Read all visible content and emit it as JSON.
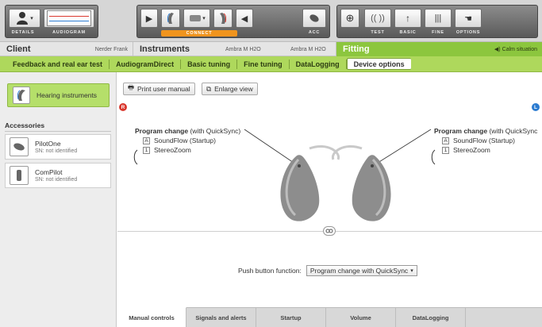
{
  "toolbar": {
    "details_label": "DETAILS",
    "audiogram_label": "AUDIOGRAM",
    "connect_label": "CONNECT",
    "acc_label": "ACC",
    "test_label": "TEST",
    "basic_label": "BASIC",
    "fine_label": "FINE",
    "options_label": "OPTIONS"
  },
  "sections": {
    "client": "Client",
    "client_name": "Nerder Frank",
    "instruments": "Instruments",
    "instrument_left": "Ambra M H2O",
    "instrument_right": "Ambra M H2O",
    "fitting": "Fitting",
    "situation": "Calm situation"
  },
  "tabs": [
    {
      "label": "Feedback and real ear test"
    },
    {
      "label": "AudiogramDirect"
    },
    {
      "label": "Basic tuning"
    },
    {
      "label": "Fine tuning"
    },
    {
      "label": "DataLogging"
    },
    {
      "label": "Device options"
    }
  ],
  "sidebar": {
    "hearing_instruments": "Hearing instruments",
    "accessories_title": "Accessories",
    "accessories": [
      {
        "name": "PilotOne",
        "sn": "SN: not identified"
      },
      {
        "name": "ComPilot",
        "sn": "SN: not identified"
      }
    ]
  },
  "main": {
    "print_label": "Print user manual",
    "enlarge_label": "Enlarge view",
    "right_badge": "R",
    "left_badge": "L",
    "right_side": {
      "title_bold": "Program change",
      "title_rest": " (with QuickSync)",
      "programs": [
        {
          "num": "A",
          "name": "SoundFlow (Startup)"
        },
        {
          "num": "1",
          "name": "StereoZoom"
        }
      ]
    },
    "left_side": {
      "title_bold": "Program change",
      "title_rest": " (with QuickSync",
      "programs": [
        {
          "num": "A",
          "name": "SoundFlow (Startup)"
        },
        {
          "num": "1",
          "name": "StereoZoom"
        }
      ]
    },
    "push_button_label": "Push button function:",
    "push_button_value": "Program change with QuickSync"
  },
  "bottom_tabs": [
    {
      "label": "Manual controls"
    },
    {
      "label": "Signals and alerts"
    },
    {
      "label": "Startup"
    },
    {
      "label": "Volume"
    },
    {
      "label": "DataLogging"
    }
  ],
  "colors": {
    "accent_green": "#8cc63e",
    "tab_green": "#aed85c",
    "connect_orange": "#f0941e",
    "right_red": "#d9382e",
    "left_blue": "#2b7bd0"
  }
}
